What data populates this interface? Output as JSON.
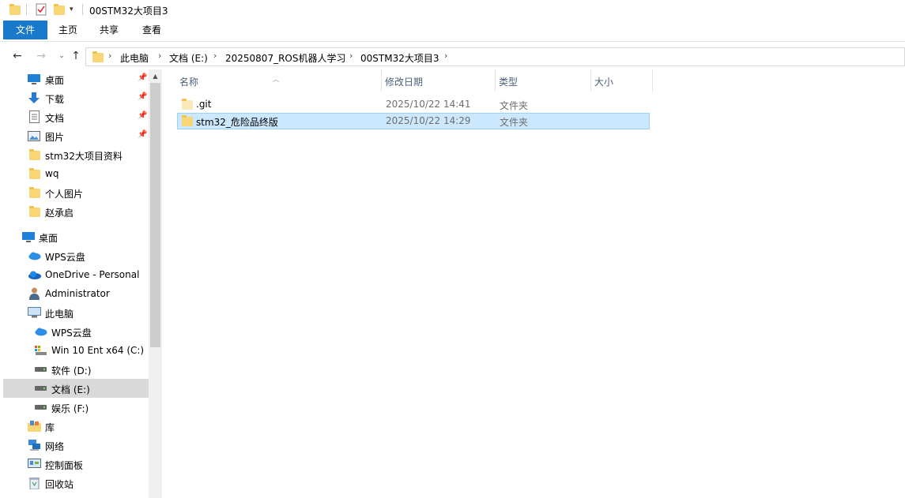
{
  "window": {
    "title": "00STM32大项目3"
  },
  "ribbon": {
    "tabs": [
      {
        "label": "文件"
      },
      {
        "label": "主页"
      },
      {
        "label": "共享"
      },
      {
        "label": "查看"
      }
    ]
  },
  "address": {
    "crumbs": [
      "此电脑",
      "文档 (E:)",
      "20250807_ROS机器人学习",
      "00STM32大项目3"
    ]
  },
  "nav": {
    "quick_access": [
      {
        "label": "桌面",
        "icon": "desktop-icon",
        "pinned": true
      },
      {
        "label": "下载",
        "icon": "download-icon",
        "pinned": true
      },
      {
        "label": "文档",
        "icon": "document-icon",
        "pinned": true
      },
      {
        "label": "图片",
        "icon": "pictures-icon",
        "pinned": true
      },
      {
        "label": "stm32大项目资料",
        "icon": "folder-icon",
        "pinned": false
      },
      {
        "label": "wq",
        "icon": "folder-icon",
        "pinned": false
      },
      {
        "label": "个人图片",
        "icon": "folder-icon",
        "pinned": false
      },
      {
        "label": "赵承启",
        "icon": "folder-icon",
        "pinned": false
      }
    ],
    "tree": [
      {
        "label": "桌面",
        "icon": "desktop-icon"
      },
      {
        "label": "WPS云盘",
        "icon": "cloud-icon"
      },
      {
        "label": "OneDrive - Personal",
        "icon": "onedrive-icon"
      },
      {
        "label": "Administrator",
        "icon": "user-icon"
      },
      {
        "label": "此电脑",
        "icon": "computer-icon"
      },
      {
        "label": "WPS云盘",
        "icon": "cloud-icon"
      },
      {
        "label": "Win 10 Ent x64 (C:)",
        "icon": "system-drive-icon"
      },
      {
        "label": "软件 (D:)",
        "icon": "drive-icon"
      },
      {
        "label": "文档 (E:)",
        "icon": "drive-icon"
      },
      {
        "label": "娱乐 (F:)",
        "icon": "drive-icon"
      },
      {
        "label": "库",
        "icon": "library-icon"
      },
      {
        "label": "网络",
        "icon": "network-icon"
      },
      {
        "label": "控制面板",
        "icon": "control-panel-icon"
      },
      {
        "label": "回收站",
        "icon": "recycle-bin-icon"
      }
    ]
  },
  "columns": {
    "name": "名称",
    "modified": "修改日期",
    "type": "类型",
    "size": "大小"
  },
  "files": [
    {
      "name": ".git",
      "modified": "2025/10/22 14:41",
      "type": "文件夹",
      "size": ""
    },
    {
      "name": "stm32_危险品终版",
      "modified": "2025/10/22 14:29",
      "type": "文件夹",
      "size": ""
    }
  ],
  "colors": {
    "accent": "#1979ca",
    "selection": "#cce8ff",
    "folder": "#f8d675"
  }
}
